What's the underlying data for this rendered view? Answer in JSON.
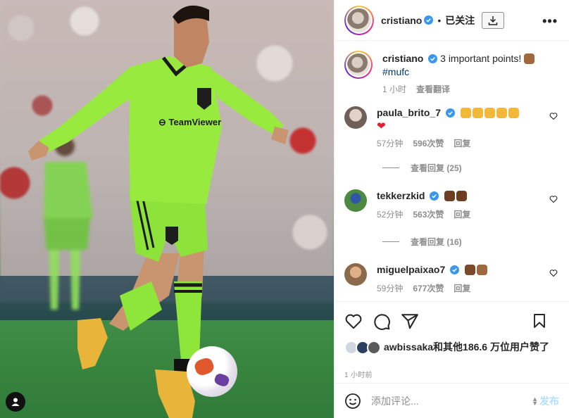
{
  "header": {
    "username": "cristiano",
    "dot": "•",
    "follow_status": "已关注",
    "more": "•••"
  },
  "caption": {
    "username": "cristiano",
    "text": "3 important points!",
    "hashtag": "#mufc",
    "time": "1 小时",
    "translate": "查看翻译"
  },
  "comments": [
    {
      "username": "paula_brito_7",
      "time": "57分钟",
      "likes": "596次赞",
      "reply": "回复",
      "view_replies": "查看回复 (25)",
      "emoji": [
        "clap",
        "clap",
        "clap",
        "clap",
        "clap",
        "red-heart"
      ]
    },
    {
      "username": "tekkerzkid",
      "time": "52分钟",
      "likes": "563次赞",
      "reply": "回复",
      "view_replies": "查看回复 (16)",
      "emoji": [
        "flexed-biceps",
        "flexed-biceps"
      ]
    },
    {
      "username": "miguelpaixao7",
      "time": "59分钟",
      "likes": "677次赞",
      "reply": "回复",
      "emoji": [
        "clap",
        "flexed-biceps"
      ]
    }
  ],
  "likes": {
    "text": "awbissaka和其他186.6 万位用户赞了"
  },
  "post_time": "1 小时前",
  "add_comment": {
    "placeholder": "添加评论...",
    "post_label": "发布"
  },
  "icons": [
    "download-icon",
    "more-icon",
    "heart-icon",
    "comment-icon",
    "share-icon",
    "bookmark-icon",
    "smile-icon",
    "user-tag-icon",
    "verified-badge-icon"
  ],
  "colors": {
    "verified": "#3897f0",
    "link": "#00376b",
    "muted": "#8e8e8e",
    "post_button": "#b2dffc",
    "kit_green": "#9bea3a"
  }
}
